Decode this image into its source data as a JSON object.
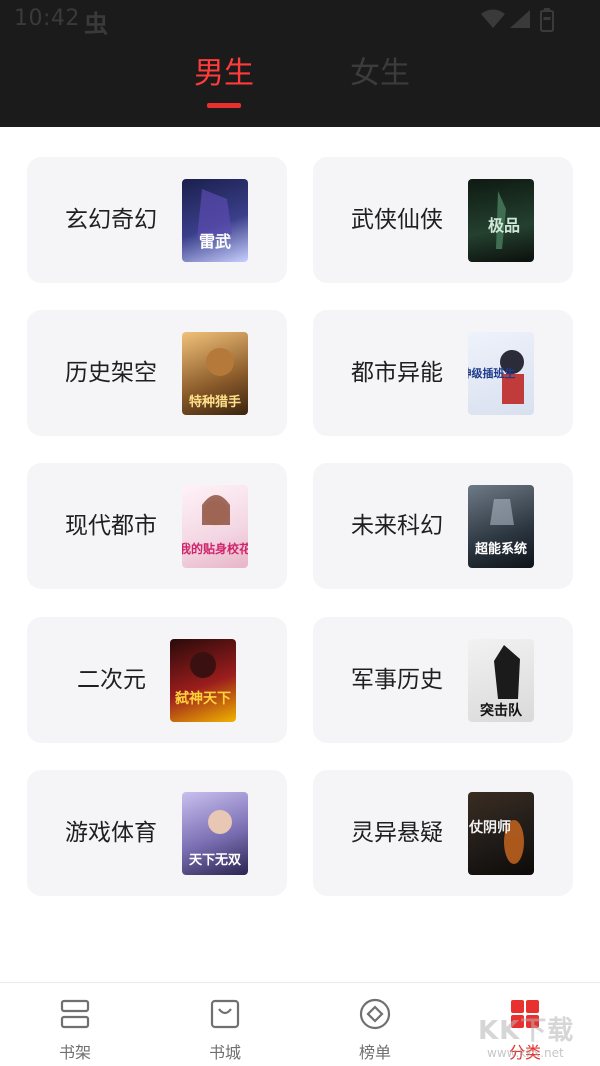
{
  "status": {
    "time": "10:42",
    "extra_glyph": "虫"
  },
  "tabs": [
    {
      "label": "男生",
      "active": true
    },
    {
      "label": "女生",
      "active": false
    }
  ],
  "categories": [
    {
      "label": "玄幻奇幻",
      "cover_title": "雷武",
      "cover_color": "#3a3f8a"
    },
    {
      "label": "武侠仙侠",
      "cover_title": "极品",
      "cover_color": "#24402f"
    },
    {
      "label": "历史架空",
      "cover_title": "特种猎手",
      "cover_color": "#8a5a2a"
    },
    {
      "label": "都市异能",
      "cover_title": "神级插班生",
      "cover_color": "#d8e0ef"
    },
    {
      "label": "现代都市",
      "cover_title": "我的贴身校花",
      "cover_color": "#f3d6e3"
    },
    {
      "label": "未来科幻",
      "cover_title": "超能系统",
      "cover_color": "#2c3640"
    },
    {
      "label": "二次元",
      "cover_title": "弑神天下",
      "cover_color": "#9b1d1d"
    },
    {
      "label": "军事历史",
      "cover_title": "突击队",
      "cover_color": "#d9d9d9"
    },
    {
      "label": "游戏体育",
      "cover_title": "天下无双",
      "cover_color": "#7b6fb3"
    },
    {
      "label": "灵异悬疑",
      "cover_title": "仗阴师",
      "cover_color": "#1e1a17"
    }
  ],
  "nav": [
    {
      "label": "书架",
      "icon": "bookshelf-icon",
      "active": false
    },
    {
      "label": "书城",
      "icon": "bookstore-icon",
      "active": false
    },
    {
      "label": "榜单",
      "icon": "ranking-icon",
      "active": false
    },
    {
      "label": "分类",
      "icon": "category-icon",
      "active": true
    }
  ],
  "watermark": {
    "text": "KK下载",
    "url": "www.kkx.net"
  },
  "colors": {
    "accent": "#e8312f",
    "header_bg": "#1b1b1b",
    "card_bg": "#f5f5f8"
  }
}
